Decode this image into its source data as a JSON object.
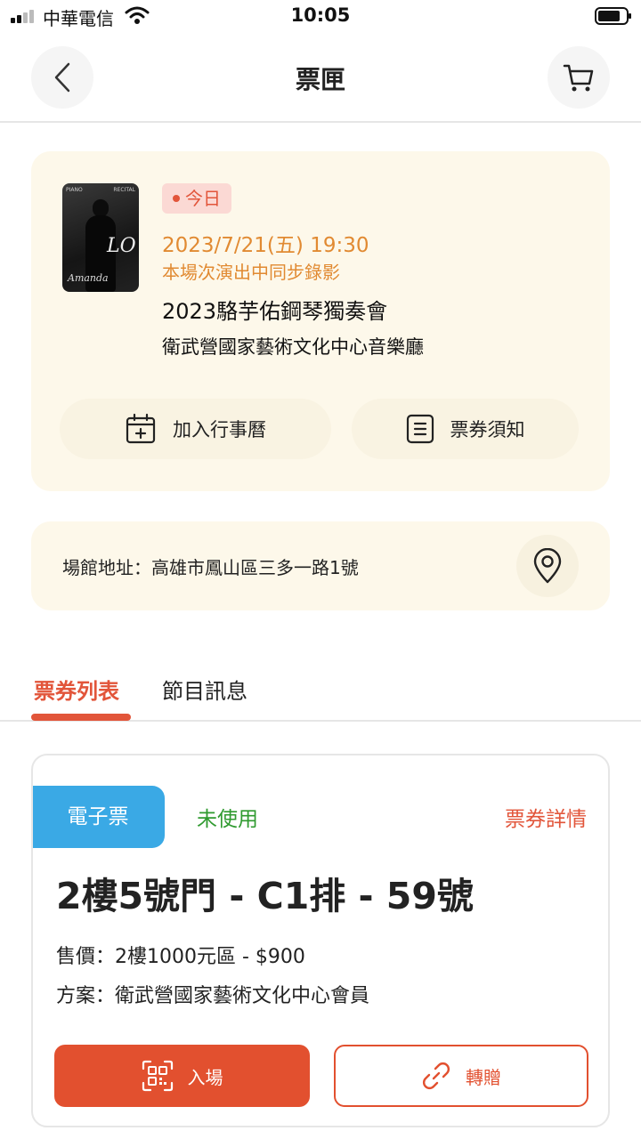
{
  "status_bar": {
    "carrier": "中華電信",
    "time": "10:05"
  },
  "header": {
    "title": "票匣",
    "back_icon": "chevron-left-icon",
    "cart_icon": "cart-icon"
  },
  "event": {
    "poster_text": {
      "top_left": "PIANO",
      "top_right": "RECITAL",
      "mark": "LO",
      "signature": "Amanda"
    },
    "badge": "今日",
    "datetime": "2023/7/21(五) 19:30",
    "note": "本場次演出中同步錄影",
    "title": "2023駱芋佑鋼琴獨奏會",
    "venue": "衛武營國家藝術文化中心音樂廳",
    "add_calendar_label": "加入行事曆",
    "ticket_notice_label": "票券須知"
  },
  "address": {
    "text": "場館地址：高雄市鳳山區三多一路1號",
    "icon": "map-pin-icon"
  },
  "tabs": {
    "ticket_list": "票券列表",
    "program_info": "節目訊息"
  },
  "ticket": {
    "type_badge": "電子票",
    "status": "未使用",
    "detail_link": "票券詳情",
    "seat": "2樓5號門 - C1排 - 59號",
    "price": "售價：2樓1000元區 - $900",
    "plan": "方案：衛武營國家藝術文化中心會員",
    "enter_label": "入場",
    "transfer_label": "轉贈"
  },
  "colors": {
    "accent": "#e2553a",
    "date_orange": "#e18a32",
    "eticket_blue": "#3aa9e5",
    "unused_green": "#2f9a2f",
    "card_cream": "#fdf8ea"
  }
}
